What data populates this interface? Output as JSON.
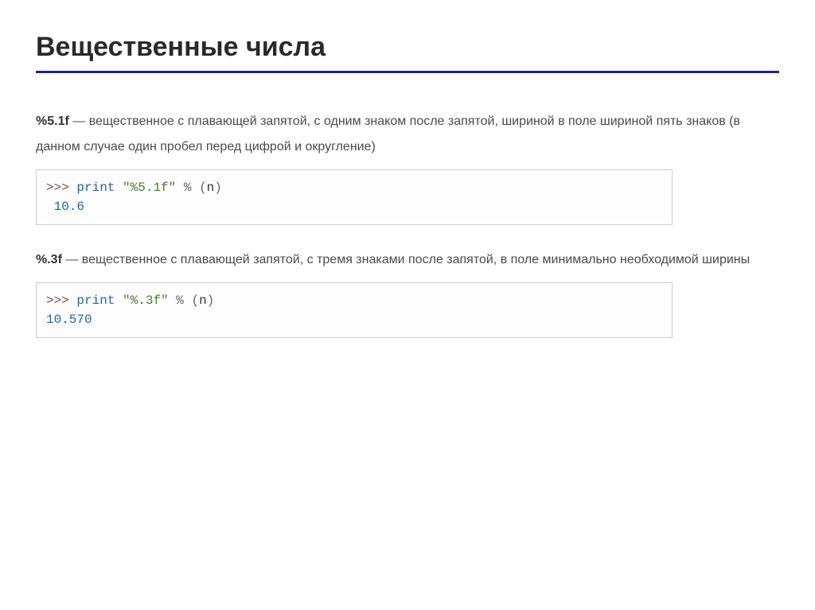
{
  "title": "Вещественные числа",
  "section1": {
    "format": "%5.1f",
    "desc": " — вещественное с плавающей запятой, с одним знаком после запятой, шириной в поле шириной пять знаков (в данном случае один пробел перед цифрой и округление)",
    "code": {
      "prompt": ">>> ",
      "keyword": "print",
      "string": "\"%5.1f\"",
      "operator": " % ",
      "paren_open": "(",
      "var": "n",
      "paren_close": ")",
      "output": " 10.6"
    }
  },
  "section2": {
    "format": "%.3f",
    "desc": " — вещественное с плавающей запятой, с тремя знаками после запятой, в поле минимально необходимой ширины",
    "code": {
      "prompt": ">>> ",
      "keyword": "print",
      "string": "\"%.3f\"",
      "operator": " % ",
      "paren_open": "(",
      "var": "n",
      "paren_close": ")",
      "output": "10.570"
    }
  }
}
